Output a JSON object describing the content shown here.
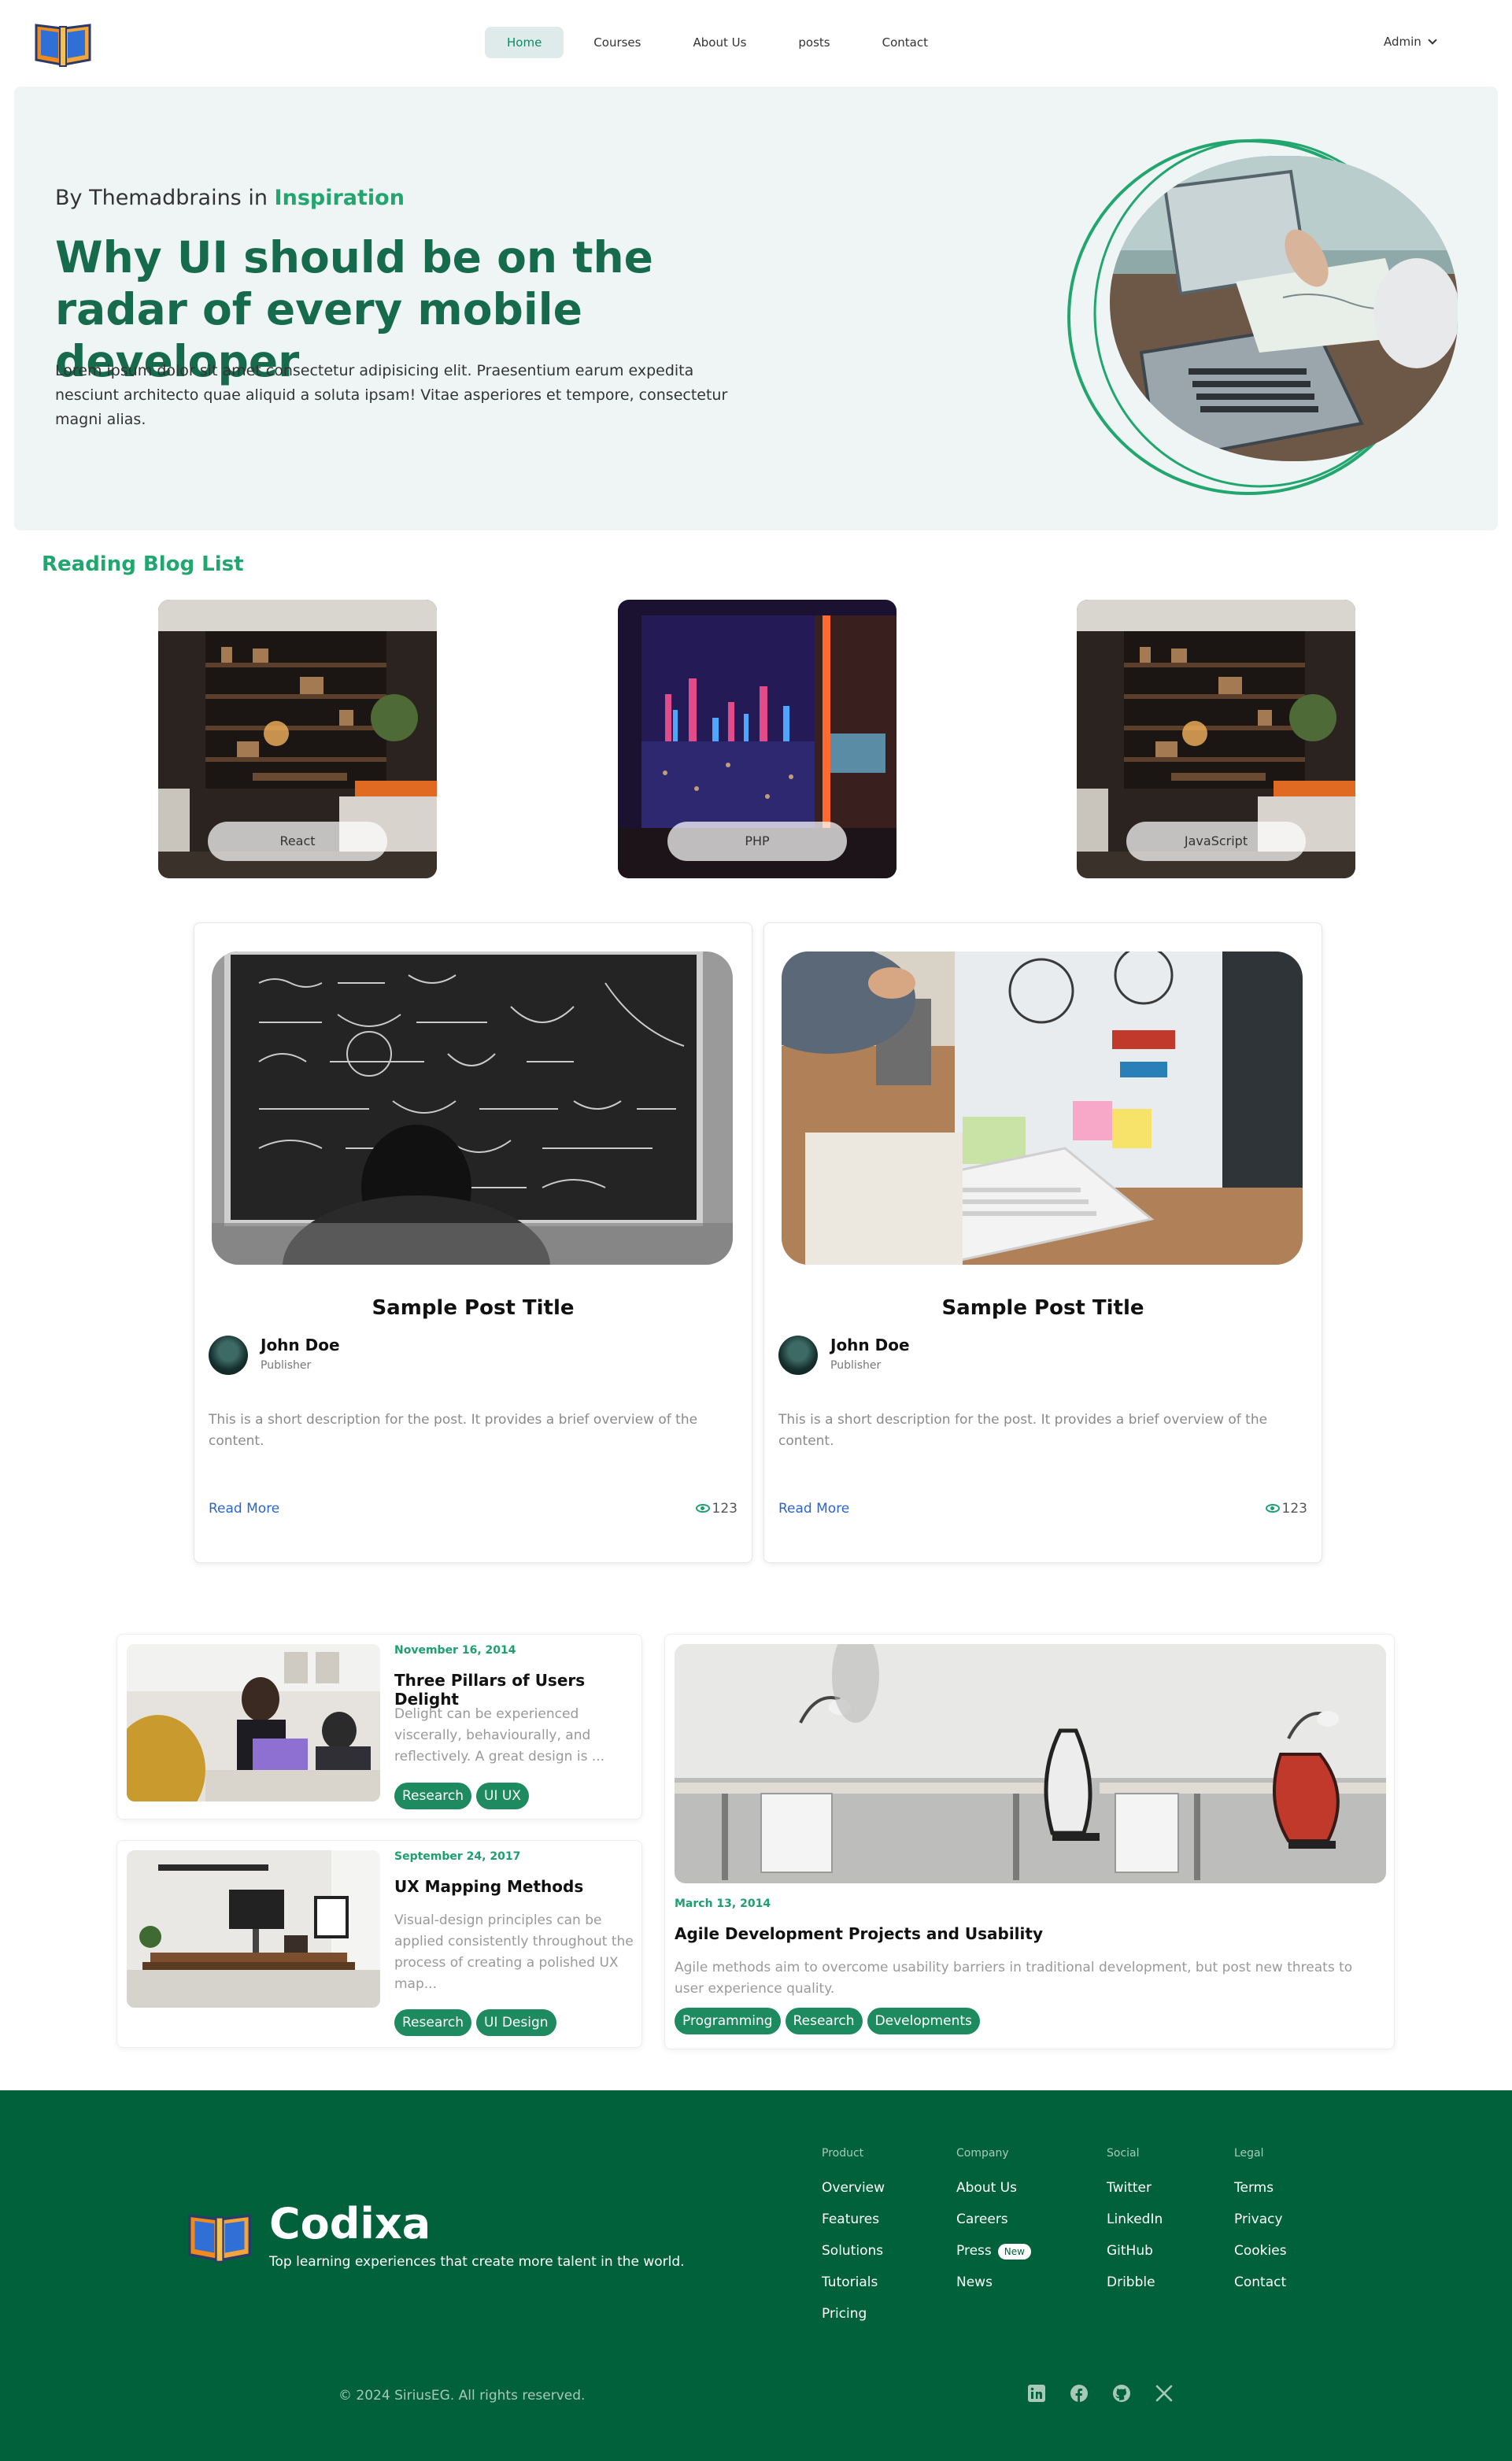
{
  "nav": {
    "links": [
      "Home",
      "Courses",
      "About Us",
      "posts",
      "Contact"
    ],
    "active": "Home",
    "user": "Admin"
  },
  "hero": {
    "byline_prefix": "By Themadbrains in",
    "byline_category": "Inspiration",
    "title": "Why UI should be on the radar of every mobile developer",
    "description": "Lorem ipsum dolor sit amet consectetur adipisicing elit. Praesentium earum expedita nesciunt architecto quae aliquid a soluta ipsam! Vitae asperiores et tempore, consectetur magni alias."
  },
  "reading_list": {
    "title": "Reading Blog List",
    "categories": [
      "React",
      "PHP",
      "JavaScript"
    ]
  },
  "posts": [
    {
      "title": "Sample Post Title",
      "author": "John Doe",
      "role": "Publisher",
      "description": "This is a short description for the post. It provides a brief overview of the content.",
      "read_more": "Read More",
      "views": "123"
    },
    {
      "title": "Sample Post Title",
      "author": "John Doe",
      "role": "Publisher",
      "description": "This is a short description for the post. It provides a brief overview of the content.",
      "read_more": "Read More",
      "views": "123"
    }
  ],
  "articles": [
    {
      "date": "November 16, 2014",
      "title": "Three Pillars of Users Delight",
      "description": "Delight can be experienced viscerally, behaviourally, and reflectively. A great design is ...",
      "tags": [
        "Research",
        "UI UX"
      ]
    },
    {
      "date": "September 24, 2017",
      "title": "UX Mapping Methods",
      "description": "Visual-design principles can be applied consistently throughout the process of creating a polished UX map...",
      "tags": [
        "Research",
        "UI Design"
      ]
    }
  ],
  "featured": {
    "date": "March 13, 2014",
    "title": "Agile Development Projects and Usability",
    "description": "Agile methods aim to overcome usability barriers in traditional development, but post new threats to user experience quality.",
    "tags": [
      "Programming",
      "Research",
      "Developments"
    ]
  },
  "footer": {
    "brand": "Codixa",
    "tagline": "Top learning experiences that create more talent in the world.",
    "columns": [
      {
        "title": "Product",
        "links": [
          "Overview",
          "Features",
          "Solutions",
          "Tutorials",
          "Pricing"
        ]
      },
      {
        "title": "Company",
        "links": [
          "About Us",
          "Careers",
          "Press",
          "News"
        ]
      },
      {
        "title": "Social",
        "links": [
          "Twitter",
          "LinkedIn",
          "GitHub",
          "Dribble"
        ]
      },
      {
        "title": "Legal",
        "links": [
          "Terms",
          "Privacy",
          "Cookies",
          "Contact"
        ]
      }
    ],
    "press_badge": "New",
    "copyright": "© 2024 SiriusEG. All rights reserved.",
    "social_icons": [
      "linkedin-icon",
      "facebook-icon",
      "github-icon",
      "x-icon"
    ]
  },
  "colors": {
    "accent": "#22a66f",
    "title_green": "#176b4d",
    "footer_bg": "#01613b",
    "tag_bg": "#1d8a60",
    "link_blue": "#2b66c8"
  }
}
